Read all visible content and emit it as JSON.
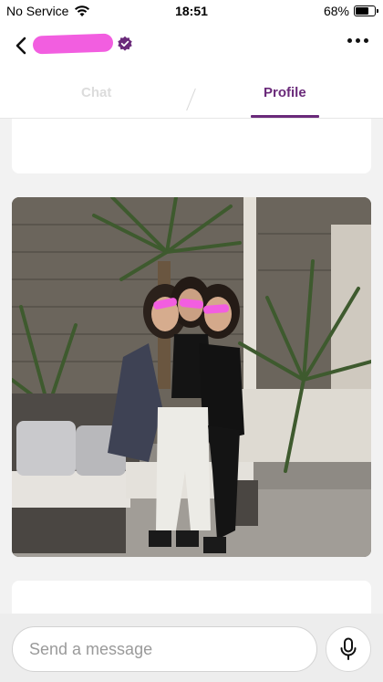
{
  "status_bar": {
    "carrier": "No Service",
    "time": "18:51",
    "battery": "68%",
    "battery_level": 0.68,
    "icons": [
      "wifi-icon",
      "battery-icon"
    ]
  },
  "header": {
    "name": "",
    "icons": [
      "back-arrow-icon",
      "verified-badge-icon",
      "more-options-icon"
    ],
    "verified_color": "#6a2a7a"
  },
  "tabs": [
    {
      "label": "Chat",
      "active": false
    },
    {
      "label": "Profile",
      "active": true
    }
  ],
  "accent_color": "#6a2a7a",
  "profile": {
    "photo_icon": "profile-photo"
  },
  "composer": {
    "placeholder": "Send a message",
    "value": "",
    "mic_icon": "microphone-icon"
  }
}
